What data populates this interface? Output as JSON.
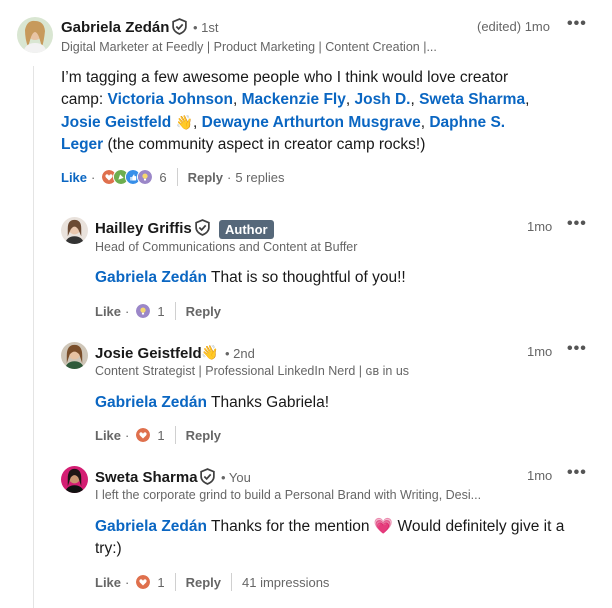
{
  "comment": {
    "author": "Gabriela Zedán",
    "degree": "• 1st",
    "headline": "Digital Marketer at Feedly | Product Marketing | Content Creation |...",
    "meta": "(edited) 1mo",
    "text_1": "I’m tagging a few awesome people who I think would love creator camp: ",
    "m1": "Victoria Johnson",
    "c1": ", ",
    "m2": "Mackenzie Fly",
    "c2": ", ",
    "m3": "Josh D.",
    "c3": ", ",
    "m4": "Sweta Sharma",
    "c4": ", ",
    "m5": "Josie Geistfeld",
    "wave": "👋",
    "c5": ", ",
    "m6": "Dewayne Arthurton Musgrave",
    "c6": ", ",
    "m7": "Daphne S. Leger",
    "text_2": " (the community aspect in creator camp rocks!)",
    "like_label": "Like",
    "dot": "·",
    "reaction_count": "6",
    "reply_label": "Reply",
    "replies_count": "5 replies"
  },
  "replies": [
    {
      "author": "Hailley Griffis",
      "badge": "Author",
      "headline": "Head of Communications and Content at Buffer",
      "meta": "1mo",
      "mention": "Gabriela Zedán",
      "text": " That is so thoughtful of you!!",
      "like_label": "Like",
      "dot": "·",
      "reaction_count": "1",
      "reply_label": "Reply"
    },
    {
      "author": "Josie Geistfeld",
      "wave": "👋",
      "degree": "• 2nd",
      "headline": "Content Strategist | Professional LinkedIn Nerd | ɢʙ in us",
      "meta": "1mo",
      "mention": "Gabriela Zedán",
      "text": " Thanks Gabriela!",
      "like_label": "Like",
      "dot": "·",
      "reaction_count": "1",
      "reply_label": "Reply"
    },
    {
      "author": "Sweta Sharma",
      "degree": "• You",
      "headline": "I left the corporate grind to build a Personal Brand with Writing, Desi...",
      "meta": "1mo",
      "mention": "Gabriela Zedán",
      "text_1": " Thanks for the mention ",
      "heart": "💗",
      "text_2": " Would definitely give it a try:)",
      "like_label": "Like",
      "dot": "·",
      "reaction_count": "1",
      "reply_label": "Reply",
      "impressions": "41 impressions"
    }
  ],
  "more_icon": "more-horizontal-icon",
  "colors": {
    "link": "#0a66c2",
    "muted": "#666666",
    "text": "#191919",
    "author_badge": "#56687a"
  }
}
